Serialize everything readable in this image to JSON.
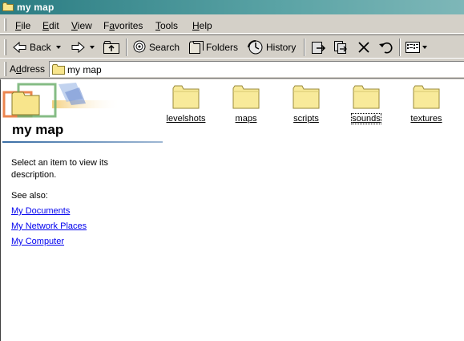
{
  "window": {
    "title": "my map"
  },
  "menu": [
    {
      "key": "F",
      "rest": "ile"
    },
    {
      "key": "E",
      "rest": "dit"
    },
    {
      "key": "V",
      "rest": "iew"
    },
    {
      "key": "F",
      "pre": "Fav",
      "rest": "orites",
      "display": "Favorites"
    },
    {
      "key": "T",
      "rest": "ools"
    },
    {
      "key": "H",
      "rest": "elp"
    }
  ],
  "toolbar": {
    "back_label": "Back",
    "search_label": "Search",
    "folders_label": "Folders",
    "history_label": "History"
  },
  "address": {
    "label_pre": "A",
    "label_key": "d",
    "label_post": "dress",
    "value": "my map"
  },
  "panel": {
    "title": "my map",
    "description": "Select an item to view its description.",
    "see_also": "See also:",
    "links": [
      "My Documents",
      "My Network Places",
      "My Computer"
    ]
  },
  "folders": [
    {
      "name": "levelshots"
    },
    {
      "name": "maps"
    },
    {
      "name": "scripts"
    },
    {
      "name": "sounds",
      "focused": true
    },
    {
      "name": "textures"
    }
  ]
}
